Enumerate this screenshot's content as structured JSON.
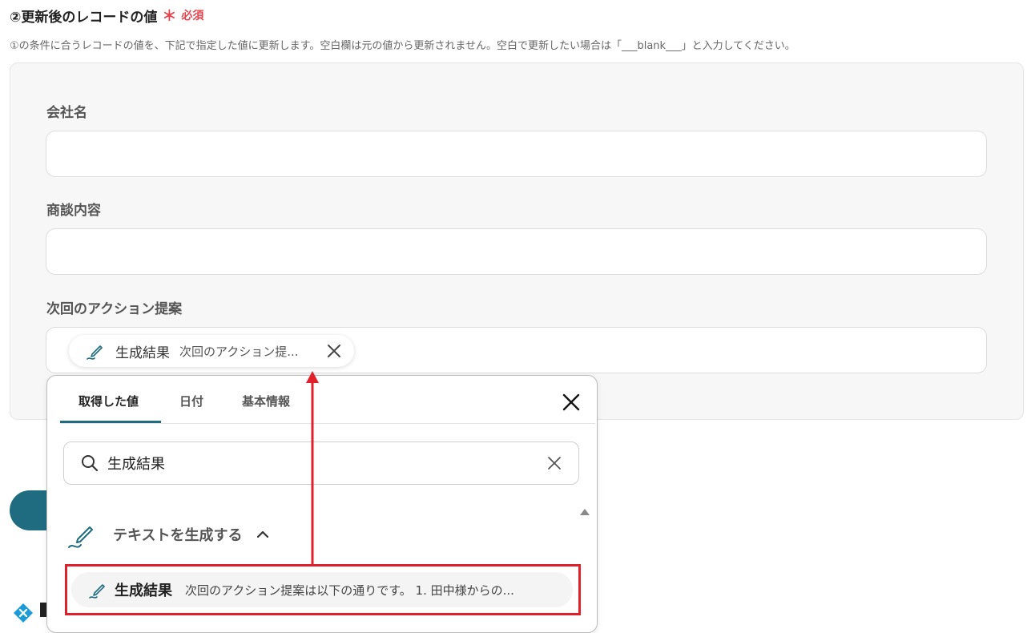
{
  "section": {
    "title": "②更新後のレコードの値",
    "required_mark": "＊",
    "required_label": "必須",
    "description": "①の条件に合うレコードの値を、下記で指定した値に更新します。空白欄は元の値から更新されません。空白で更新したい場合は「___blank___」と入力してください。"
  },
  "fields": [
    {
      "label": "会社名",
      "value": ""
    },
    {
      "label": "商談内容",
      "value": ""
    },
    {
      "label": "次回のアクション提案",
      "value": ""
    }
  ],
  "chip": {
    "icon": "pen-icon",
    "name": "生成結果",
    "preview": "次回のアクション提..."
  },
  "popup": {
    "tabs": [
      {
        "label": "取得した値",
        "active": true
      },
      {
        "label": "日付",
        "active": false
      },
      {
        "label": "基本情報",
        "active": false
      }
    ],
    "search": {
      "value": "生成結果",
      "placeholder": ""
    },
    "group": {
      "label": "テキストを生成する",
      "expanded": true
    },
    "result": {
      "name": "生成結果",
      "preview": "次回のアクション提案は以下の通りです。 1. 田中様からの..."
    }
  },
  "colors": {
    "accent": "#1f6c80",
    "required": "#e2454d",
    "highlight": "#e0202a",
    "panel_bg": "#f7f7f7"
  }
}
